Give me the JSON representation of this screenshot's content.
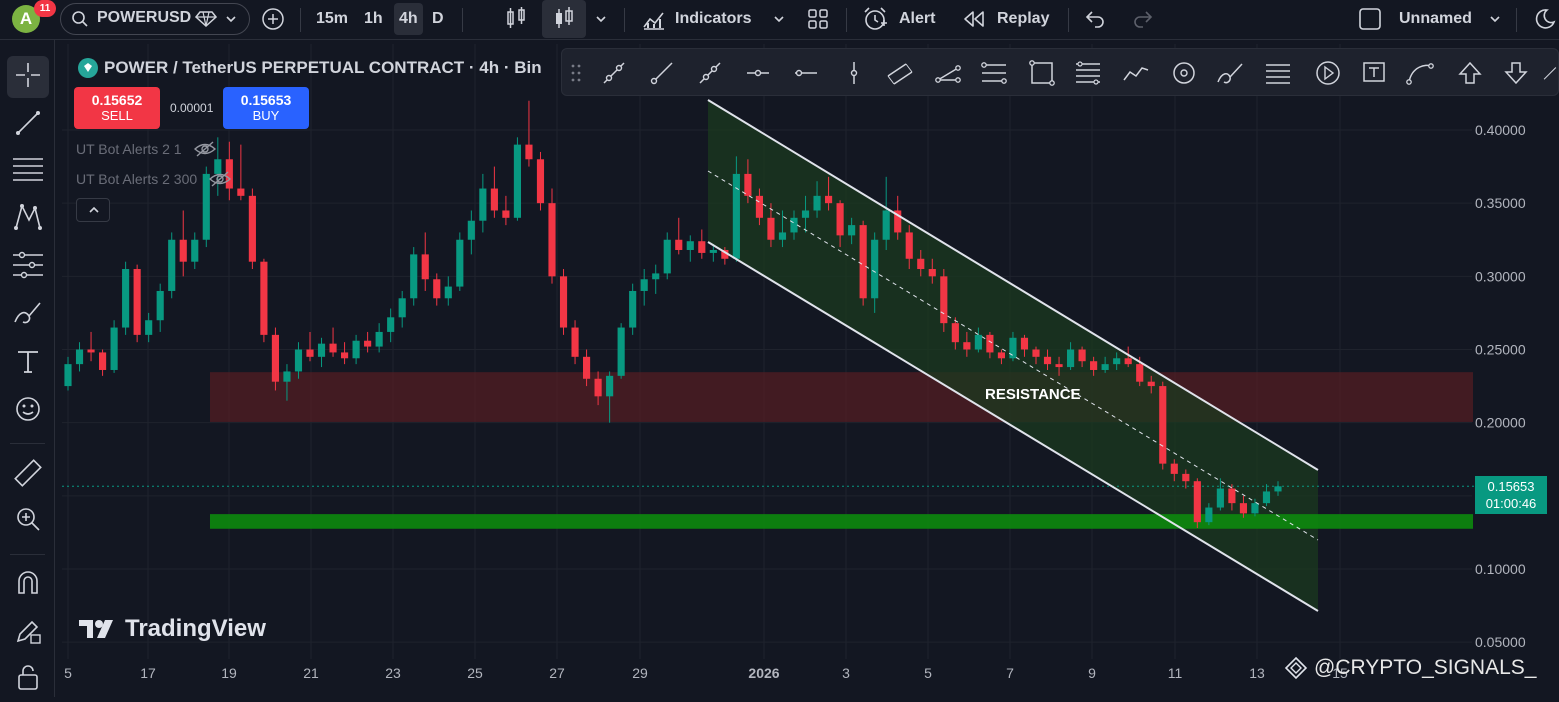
{
  "topbar": {
    "avatar_letter": "A",
    "notifications": "11",
    "symbol": "POWERUSD",
    "intervals": [
      "15m",
      "1h",
      "4h",
      "D"
    ],
    "indicators_label": "Indicators",
    "alert_label": "Alert",
    "replay_label": "Replay",
    "layout_name": "Unnamed"
  },
  "legend": {
    "title": "POWER / TetherUS PERPETUAL CONTRACT · 4h · Bin",
    "sell_price": "0.15652",
    "sell_label": "SELL",
    "spread": "0.00001",
    "buy_price": "0.15653",
    "buy_label": "BUY",
    "indicators": [
      "UT Bot Alerts 2 1",
      "UT Bot Alerts 2 300"
    ]
  },
  "annotations": {
    "resistance_label": "RESISTANCE",
    "watermark": "TradingView",
    "signature": "@CRYPTO_SIGNALS_"
  },
  "price_scale": {
    "labels": [
      "0.40000",
      "0.35000",
      "0.30000",
      "0.25000",
      "0.20000",
      "0.10000",
      "0.05000"
    ],
    "current_price": "0.15653",
    "countdown": "01:00:46"
  },
  "time_scale": {
    "labels": [
      "5",
      "17",
      "19",
      "21",
      "23",
      "25",
      "27",
      "29",
      "2026",
      "3",
      "5",
      "7",
      "9",
      "11",
      "13",
      "15"
    ]
  },
  "colors": {
    "up": "#089981",
    "down": "#f23645",
    "background": "#131722",
    "resistance_zone": "#5c1d24",
    "support_zone": "#0d8a0d",
    "channel_fill": "#1b3a1f",
    "accent": "#2962ff"
  },
  "chart_data": {
    "type": "candlestick",
    "symbol": "POWER / TetherUS PERPETUAL CONTRACT",
    "interval": "4h",
    "ylim": [
      0.04,
      0.42
    ],
    "x_ticks": [
      "5",
      "17",
      "19",
      "21",
      "23",
      "25",
      "27",
      "29",
      "2026",
      "3",
      "5",
      "7",
      "9",
      "11",
      "13",
      "15"
    ],
    "candles": [
      {
        "o": 0.225,
        "h": 0.245,
        "l": 0.222,
        "c": 0.24
      },
      {
        "o": 0.24,
        "h": 0.255,
        "l": 0.235,
        "c": 0.25
      },
      {
        "o": 0.25,
        "h": 0.262,
        "l": 0.242,
        "c": 0.248
      },
      {
        "o": 0.248,
        "h": 0.25,
        "l": 0.232,
        "c": 0.236
      },
      {
        "o": 0.236,
        "h": 0.27,
        "l": 0.234,
        "c": 0.265
      },
      {
        "o": 0.265,
        "h": 0.31,
        "l": 0.26,
        "c": 0.305
      },
      {
        "o": 0.305,
        "h": 0.308,
        "l": 0.255,
        "c": 0.26
      },
      {
        "o": 0.26,
        "h": 0.275,
        "l": 0.255,
        "c": 0.27
      },
      {
        "o": 0.27,
        "h": 0.295,
        "l": 0.262,
        "c": 0.29
      },
      {
        "o": 0.29,
        "h": 0.33,
        "l": 0.285,
        "c": 0.325
      },
      {
        "o": 0.325,
        "h": 0.345,
        "l": 0.3,
        "c": 0.31
      },
      {
        "o": 0.31,
        "h": 0.33,
        "l": 0.305,
        "c": 0.325
      },
      {
        "o": 0.325,
        "h": 0.375,
        "l": 0.32,
        "c": 0.37
      },
      {
        "o": 0.37,
        "h": 0.395,
        "l": 0.355,
        "c": 0.38
      },
      {
        "o": 0.38,
        "h": 0.392,
        "l": 0.352,
        "c": 0.36
      },
      {
        "o": 0.36,
        "h": 0.39,
        "l": 0.352,
        "c": 0.355
      },
      {
        "o": 0.355,
        "h": 0.36,
        "l": 0.305,
        "c": 0.31
      },
      {
        "o": 0.31,
        "h": 0.312,
        "l": 0.255,
        "c": 0.26
      },
      {
        "o": 0.26,
        "h": 0.265,
        "l": 0.222,
        "c": 0.228
      },
      {
        "o": 0.228,
        "h": 0.24,
        "l": 0.215,
        "c": 0.235
      },
      {
        "o": 0.235,
        "h": 0.255,
        "l": 0.23,
        "c": 0.25
      },
      {
        "o": 0.25,
        "h": 0.262,
        "l": 0.242,
        "c": 0.245
      },
      {
        "o": 0.245,
        "h": 0.258,
        "l": 0.238,
        "c": 0.254
      },
      {
        "o": 0.254,
        "h": 0.265,
        "l": 0.245,
        "c": 0.248
      },
      {
        "o": 0.248,
        "h": 0.255,
        "l": 0.24,
        "c": 0.244
      },
      {
        "o": 0.244,
        "h": 0.26,
        "l": 0.24,
        "c": 0.256
      },
      {
        "o": 0.256,
        "h": 0.262,
        "l": 0.248,
        "c": 0.252
      },
      {
        "o": 0.252,
        "h": 0.268,
        "l": 0.248,
        "c": 0.262
      },
      {
        "o": 0.262,
        "h": 0.278,
        "l": 0.255,
        "c": 0.272
      },
      {
        "o": 0.272,
        "h": 0.29,
        "l": 0.265,
        "c": 0.285
      },
      {
        "o": 0.285,
        "h": 0.32,
        "l": 0.28,
        "c": 0.315
      },
      {
        "o": 0.315,
        "h": 0.33,
        "l": 0.29,
        "c": 0.298
      },
      {
        "o": 0.298,
        "h": 0.302,
        "l": 0.28,
        "c": 0.285
      },
      {
        "o": 0.285,
        "h": 0.3,
        "l": 0.28,
        "c": 0.293
      },
      {
        "o": 0.293,
        "h": 0.33,
        "l": 0.29,
        "c": 0.325
      },
      {
        "o": 0.325,
        "h": 0.345,
        "l": 0.315,
        "c": 0.338
      },
      {
        "o": 0.338,
        "h": 0.37,
        "l": 0.33,
        "c": 0.36
      },
      {
        "o": 0.36,
        "h": 0.375,
        "l": 0.34,
        "c": 0.345
      },
      {
        "o": 0.345,
        "h": 0.355,
        "l": 0.335,
        "c": 0.34
      },
      {
        "o": 0.34,
        "h": 0.395,
        "l": 0.338,
        "c": 0.39
      },
      {
        "o": 0.39,
        "h": 0.42,
        "l": 0.375,
        "c": 0.38
      },
      {
        "o": 0.38,
        "h": 0.385,
        "l": 0.345,
        "c": 0.35
      },
      {
        "o": 0.35,
        "h": 0.36,
        "l": 0.295,
        "c": 0.3
      },
      {
        "o": 0.3,
        "h": 0.305,
        "l": 0.26,
        "c": 0.265
      },
      {
        "o": 0.265,
        "h": 0.27,
        "l": 0.24,
        "c": 0.245
      },
      {
        "o": 0.245,
        "h": 0.25,
        "l": 0.225,
        "c": 0.23
      },
      {
        "o": 0.23,
        "h": 0.235,
        "l": 0.212,
        "c": 0.218
      },
      {
        "o": 0.218,
        "h": 0.235,
        "l": 0.2,
        "c": 0.232
      },
      {
        "o": 0.232,
        "h": 0.268,
        "l": 0.23,
        "c": 0.265
      },
      {
        "o": 0.265,
        "h": 0.295,
        "l": 0.26,
        "c": 0.29
      },
      {
        "o": 0.29,
        "h": 0.305,
        "l": 0.28,
        "c": 0.298
      },
      {
        "o": 0.298,
        "h": 0.308,
        "l": 0.288,
        "c": 0.302
      },
      {
        "o": 0.302,
        "h": 0.33,
        "l": 0.298,
        "c": 0.325
      },
      {
        "o": 0.325,
        "h": 0.34,
        "l": 0.315,
        "c": 0.318
      },
      {
        "o": 0.318,
        "h": 0.328,
        "l": 0.31,
        "c": 0.324
      },
      {
        "o": 0.324,
        "h": 0.332,
        "l": 0.312,
        "c": 0.316
      },
      {
        "o": 0.316,
        "h": 0.322,
        "l": 0.31,
        "c": 0.318
      },
      {
        "o": 0.318,
        "h": 0.32,
        "l": 0.308,
        "c": 0.312
      },
      {
        "o": 0.312,
        "h": 0.382,
        "l": 0.31,
        "c": 0.37
      },
      {
        "o": 0.37,
        "h": 0.38,
        "l": 0.35,
        "c": 0.355
      },
      {
        "o": 0.355,
        "h": 0.36,
        "l": 0.335,
        "c": 0.34
      },
      {
        "o": 0.34,
        "h": 0.35,
        "l": 0.32,
        "c": 0.325
      },
      {
        "o": 0.325,
        "h": 0.345,
        "l": 0.32,
        "c": 0.33
      },
      {
        "o": 0.33,
        "h": 0.345,
        "l": 0.325,
        "c": 0.34
      },
      {
        "o": 0.34,
        "h": 0.355,
        "l": 0.33,
        "c": 0.345
      },
      {
        "o": 0.345,
        "h": 0.365,
        "l": 0.34,
        "c": 0.355
      },
      {
        "o": 0.355,
        "h": 0.368,
        "l": 0.345,
        "c": 0.35
      },
      {
        "o": 0.35,
        "h": 0.352,
        "l": 0.32,
        "c": 0.328
      },
      {
        "o": 0.328,
        "h": 0.34,
        "l": 0.322,
        "c": 0.335
      },
      {
        "o": 0.335,
        "h": 0.338,
        "l": 0.28,
        "c": 0.285
      },
      {
        "o": 0.285,
        "h": 0.33,
        "l": 0.275,
        "c": 0.325
      },
      {
        "o": 0.325,
        "h": 0.368,
        "l": 0.318,
        "c": 0.345
      },
      {
        "o": 0.345,
        "h": 0.355,
        "l": 0.325,
        "c": 0.33
      },
      {
        "o": 0.33,
        "h": 0.335,
        "l": 0.305,
        "c": 0.312
      },
      {
        "o": 0.312,
        "h": 0.318,
        "l": 0.3,
        "c": 0.305
      },
      {
        "o": 0.305,
        "h": 0.312,
        "l": 0.295,
        "c": 0.3
      },
      {
        "o": 0.3,
        "h": 0.305,
        "l": 0.262,
        "c": 0.268
      },
      {
        "o": 0.268,
        "h": 0.272,
        "l": 0.25,
        "c": 0.255
      },
      {
        "o": 0.255,
        "h": 0.262,
        "l": 0.245,
        "c": 0.25
      },
      {
        "o": 0.25,
        "h": 0.265,
        "l": 0.248,
        "c": 0.26
      },
      {
        "o": 0.26,
        "h": 0.262,
        "l": 0.244,
        "c": 0.248
      },
      {
        "o": 0.248,
        "h": 0.25,
        "l": 0.24,
        "c": 0.244
      },
      {
        "o": 0.244,
        "h": 0.262,
        "l": 0.242,
        "c": 0.258
      },
      {
        "o": 0.258,
        "h": 0.26,
        "l": 0.245,
        "c": 0.25
      },
      {
        "o": 0.25,
        "h": 0.252,
        "l": 0.24,
        "c": 0.245
      },
      {
        "o": 0.245,
        "h": 0.25,
        "l": 0.236,
        "c": 0.24
      },
      {
        "o": 0.24,
        "h": 0.245,
        "l": 0.232,
        "c": 0.238
      },
      {
        "o": 0.238,
        "h": 0.255,
        "l": 0.236,
        "c": 0.25
      },
      {
        "o": 0.25,
        "h": 0.252,
        "l": 0.238,
        "c": 0.242
      },
      {
        "o": 0.242,
        "h": 0.245,
        "l": 0.232,
        "c": 0.236
      },
      {
        "o": 0.236,
        "h": 0.245,
        "l": 0.234,
        "c": 0.24
      },
      {
        "o": 0.24,
        "h": 0.248,
        "l": 0.236,
        "c": 0.244
      },
      {
        "o": 0.244,
        "h": 0.252,
        "l": 0.238,
        "c": 0.24
      },
      {
        "o": 0.24,
        "h": 0.245,
        "l": 0.225,
        "c": 0.228
      },
      {
        "o": 0.228,
        "h": 0.232,
        "l": 0.22,
        "c": 0.225
      },
      {
        "o": 0.225,
        "h": 0.228,
        "l": 0.168,
        "c": 0.172
      },
      {
        "o": 0.172,
        "h": 0.175,
        "l": 0.16,
        "c": 0.165
      },
      {
        "o": 0.165,
        "h": 0.168,
        "l": 0.155,
        "c": 0.16
      },
      {
        "o": 0.16,
        "h": 0.162,
        "l": 0.128,
        "c": 0.132
      },
      {
        "o": 0.132,
        "h": 0.145,
        "l": 0.13,
        "c": 0.142
      },
      {
        "o": 0.142,
        "h": 0.162,
        "l": 0.14,
        "c": 0.155
      },
      {
        "o": 0.155,
        "h": 0.158,
        "l": 0.14,
        "c": 0.145
      },
      {
        "o": 0.145,
        "h": 0.15,
        "l": 0.135,
        "c": 0.138
      },
      {
        "o": 0.138,
        "h": 0.148,
        "l": 0.136,
        "c": 0.145
      },
      {
        "o": 0.145,
        "h": 0.158,
        "l": 0.143,
        "c": 0.153
      },
      {
        "o": 0.153,
        "h": 0.16,
        "l": 0.15,
        "c": 0.1565
      }
    ],
    "resistance_zone": [
      0.2005,
      0.2345
    ],
    "support_zone": [
      0.1275,
      0.1375
    ],
    "current_price": 0.15653
  }
}
